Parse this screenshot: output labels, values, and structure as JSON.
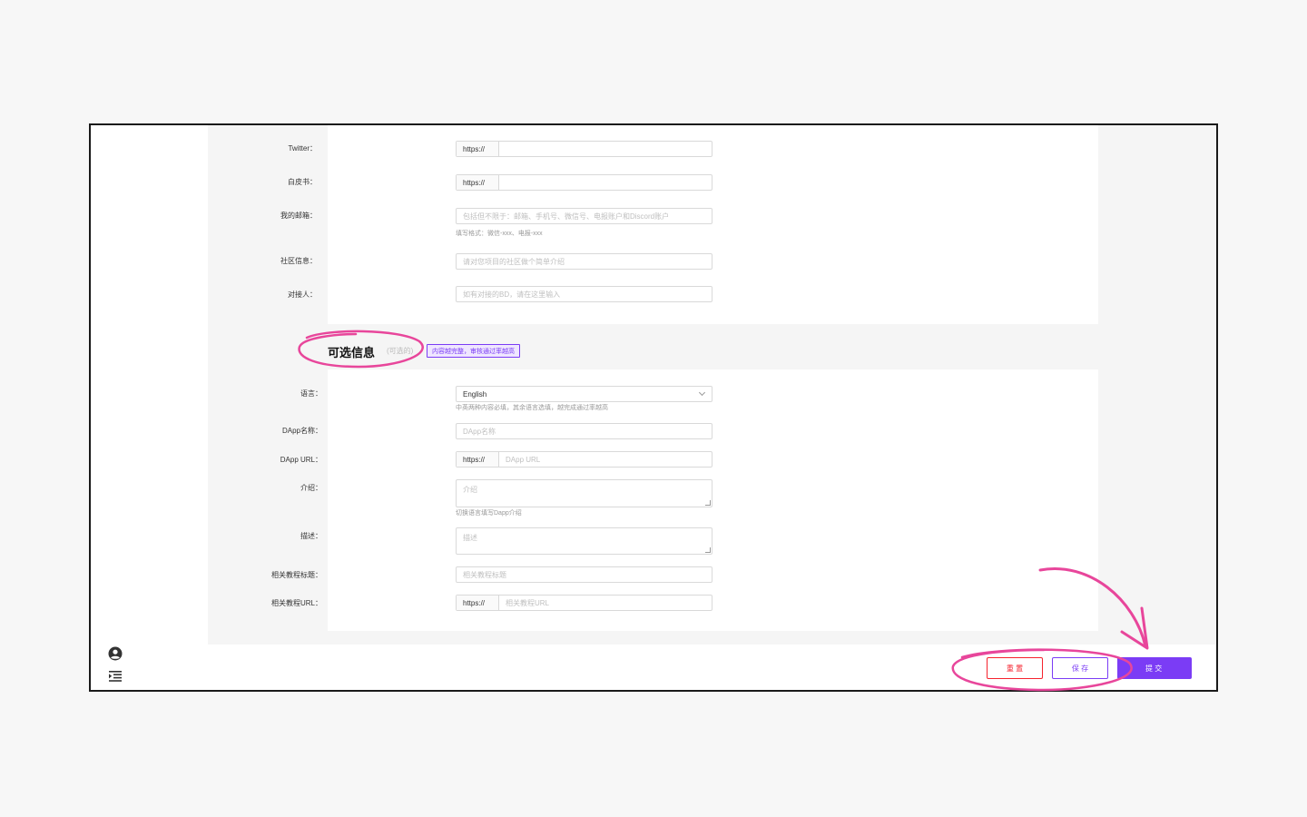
{
  "top_form": {
    "rows": [
      {
        "label": "Twitter：",
        "addon": "https://",
        "placeholder": "",
        "helper": ""
      },
      {
        "label": "白皮书：",
        "addon": "https://",
        "placeholder": "",
        "helper": ""
      },
      {
        "label": "我的邮箱：",
        "addon": "",
        "placeholder": "包括但不限于：邮箱、手机号、微信号、电报账户和Discord账户",
        "helper": "填写格式：微信-xxx、电报-xxx"
      },
      {
        "label": "社区信息：",
        "addon": "",
        "placeholder": "请对您项目的社区做个简单介绍",
        "helper": ""
      },
      {
        "label": "对接人：",
        "addon": "",
        "placeholder": "如有对接的BD，请在这里输入",
        "helper": ""
      }
    ]
  },
  "optional_section": {
    "title": "可选信息",
    "subtitle": "(可选的)",
    "tag": "内容越完整，审核通过率越高"
  },
  "optional_form": {
    "language": {
      "label": "语言：",
      "value": "English",
      "helper": "中英两种内容必填，其余语言选填，越完成通过率越高"
    },
    "dapp_name": {
      "label": "DApp名称：",
      "placeholder": "DApp名称"
    },
    "dapp_url": {
      "label": "DApp URL：",
      "addon": "https://",
      "placeholder": "DApp URL"
    },
    "intro": {
      "label": "介绍：",
      "placeholder": "介绍",
      "helper": "切换语言填写Dapp介绍"
    },
    "description": {
      "label": "描述：",
      "placeholder": "描述"
    },
    "tutorial_title": {
      "label": "相关教程标题：",
      "placeholder": "相关教程标题"
    },
    "tutorial_url": {
      "label": "相关教程URL：",
      "addon": "https://",
      "placeholder": "相关教程URL"
    }
  },
  "footer": {
    "reset_label": "重 置",
    "save_label": "保 存",
    "submit_label": "提 交"
  },
  "icons": {
    "user": "user-circle-icon",
    "menu": "menu-indent-icon"
  },
  "colors": {
    "accent": "#7b3cf5",
    "danger": "#f5222d",
    "annotation": "#e8469b"
  }
}
